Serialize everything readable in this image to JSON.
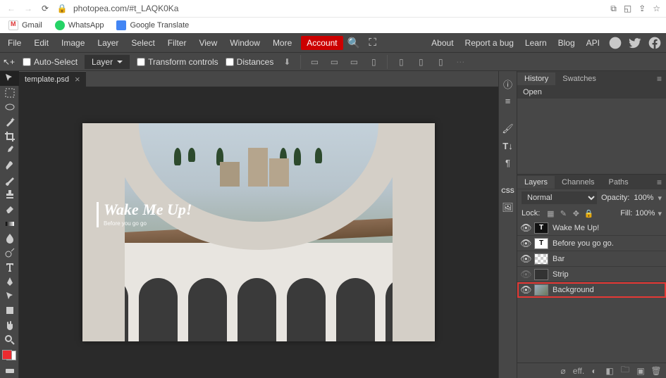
{
  "browser": {
    "url": "photopea.com/#t_LAQK0Ka",
    "bookmarks": [
      {
        "label": "Gmail"
      },
      {
        "label": "WhatsApp"
      },
      {
        "label": "Google Translate"
      }
    ]
  },
  "menu": {
    "items": [
      "File",
      "Edit",
      "Image",
      "Layer",
      "Select",
      "Filter",
      "View",
      "Window",
      "More"
    ],
    "account": "Account",
    "right": [
      "About",
      "Report a bug",
      "Learn",
      "Blog",
      "API"
    ]
  },
  "options": {
    "auto_select": "Auto-Select",
    "layer_dd": "Layer",
    "transform": "Transform controls",
    "distances": "Distances"
  },
  "document": {
    "tab": "template.psd"
  },
  "canvas": {
    "title": "Wake Me Up!",
    "subtitle": "Before you go go"
  },
  "history_panel": {
    "tabs": [
      "History",
      "Swatches"
    ],
    "items": [
      "Open"
    ]
  },
  "layers_panel": {
    "tabs": [
      "Layers",
      "Channels",
      "Paths"
    ],
    "blend": "Normal",
    "opacity_label": "Opacity:",
    "opacity_value": "100%",
    "lock_label": "Lock:",
    "fill_label": "Fill:",
    "fill_value": "100%",
    "layers": [
      {
        "name": "Wake Me Up!",
        "type": "text-bold"
      },
      {
        "name": "Before you go go.",
        "type": "text"
      },
      {
        "name": "Bar",
        "type": "checker"
      },
      {
        "name": "Strip",
        "type": "solid"
      },
      {
        "name": "Background",
        "type": "image",
        "selected": true
      }
    ]
  }
}
